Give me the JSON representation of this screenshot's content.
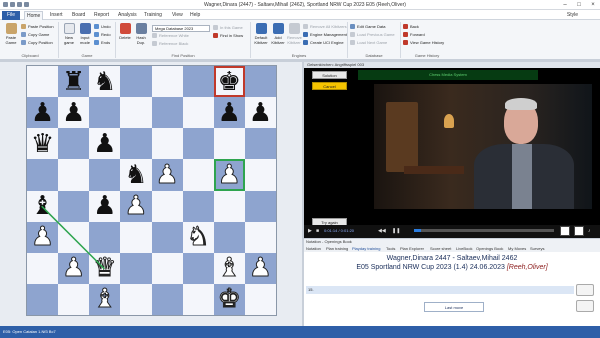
{
  "title_bar": {
    "text": "Wagner,Dinara (2447) - Saltaev,Mihail (2462), Sportland NRW Cup 2023 E05 (Reeh,Oliver)"
  },
  "menu": {
    "file": "File",
    "tabs": [
      "Home",
      "Insert",
      "Board",
      "Report",
      "Analysis",
      "Training",
      "View",
      "Help"
    ],
    "style_label": "Style"
  },
  "ribbon": {
    "clipboard": {
      "paste_game": "Paste Game",
      "paste_position": "Paste Position",
      "copy_game": "Copy Game",
      "copy_position": "Copy Position",
      "group_label": "Clipboard"
    },
    "game": {
      "new_game": "New game",
      "input_mode": "Input mode",
      "undo": "Undo",
      "redo": "Redo",
      "ends": "Ends",
      "group_label": "Game"
    },
    "find_position": {
      "delete": "Delete",
      "hash_dup": "Hash Dup.",
      "database_select": "Mega Database 2023",
      "reference_white": "Reference White",
      "reference_black": "Reference Black",
      "in_this_game": "In this Game",
      "find_in_show": "Find in Show",
      "group_label": "Find Position"
    },
    "engines": {
      "default_kibitzer": "Default Kibitzer",
      "add_kibitzer": "Add Kibitzer",
      "remove_kibitzer": "Remove Kibitzer",
      "remove_all_kibitzers": "Remove All Kibitzers",
      "engine_management": "Engine Management",
      "create_uci_engine": "Create UCI Engine",
      "group_label": "Engines"
    },
    "database": {
      "edit_game_data": "Edit Game Data",
      "load_previous_game": "Load Previous Game",
      "load_next_game": "Load Next Game",
      "group_label": "Database"
    },
    "game_history": {
      "back": "Back",
      "forward": "Forward",
      "view_game_history": "View Game History",
      "group_label": "Game History"
    }
  },
  "board": {
    "rows": [
      [
        "",
        "r",
        "n",
        "",
        "",
        "",
        "k",
        ""
      ],
      [
        "p",
        "p",
        "",
        "",
        "",
        "",
        "p",
        "p"
      ],
      [
        "q",
        "",
        "p",
        "",
        "",
        "",
        "",
        ""
      ],
      [
        "",
        "",
        "",
        "n",
        "P",
        "",
        "P",
        ""
      ],
      [
        "b",
        "",
        "p",
        "P",
        "",
        "",
        "",
        ""
      ],
      [
        "P",
        "",
        "",
        "",
        "",
        "N",
        "",
        ""
      ],
      [
        "",
        "P",
        "Q",
        "",
        "",
        "",
        "B",
        "P"
      ],
      [
        "",
        "",
        "B",
        "",
        "",
        "",
        "K",
        ""
      ]
    ],
    "highlight_red": "g8",
    "highlight_green": "g5",
    "arrow_from": "a4",
    "arrow_to": "c2"
  },
  "video": {
    "window_title": "Gelsenkirchen: Angriffsspiel 003",
    "solution": "Solution",
    "cancel": "Cancel",
    "banner": "Chess Media System",
    "try_again": "Try again",
    "time": "0:01:14 / 0:01:20",
    "progress": 0.05
  },
  "notation": {
    "caption": "Notation - Openings Book",
    "tabs": [
      "Notation",
      "Plan training",
      "Playday training",
      "Tools",
      "Plan Explorer",
      "Score sheet",
      "LiveBook",
      "Openings Book",
      "My Moves",
      "Surveys"
    ],
    "active_tab": "Playday training",
    "players": "Wagner,Dinara 2447 - Saltaev,Mihail 2462",
    "event": "E05 Sportland NRW Cup 2023 (1.4) 24.06.2023",
    "annotator": "[Reeh,Oliver]",
    "move_row": "15.",
    "last_move": "Last move"
  },
  "status": {
    "text": "E05: Open Catalan 1.Nf3 Bc7"
  },
  "colors": {
    "accent": "#2e5fa8",
    "board_dark": "#8ea4cf",
    "board_light": "#f4f6fb",
    "highlight_red": "#c0392b",
    "highlight_green": "#2ea44f",
    "cancel_yellow": "#f5c400"
  }
}
